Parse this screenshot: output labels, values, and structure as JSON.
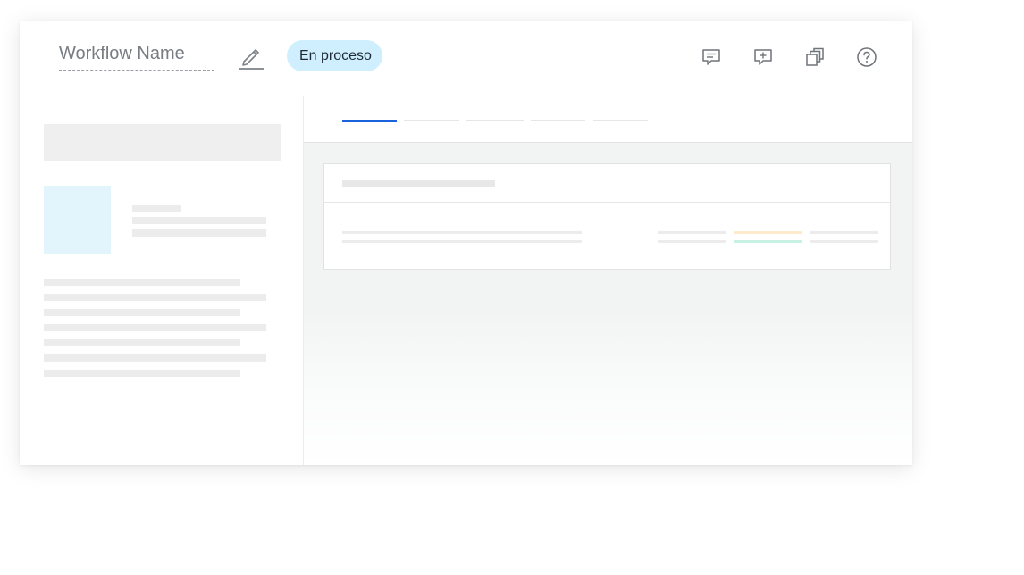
{
  "header": {
    "workflow_name_placeholder": "Workflow Name",
    "status_label": "En proceso",
    "actions": [
      {
        "name": "comments",
        "icon": "comment-icon"
      },
      {
        "name": "add-comment",
        "icon": "add-comment-icon"
      },
      {
        "name": "copy",
        "icon": "copy-icon"
      },
      {
        "name": "help",
        "icon": "help-icon"
      }
    ]
  },
  "tabs": {
    "active_index": 0,
    "count": 5
  },
  "colors": {
    "accent": "#1a63dd",
    "status_badge_bg": "#cfefff",
    "skeleton": "#ececec",
    "thumbnail": "#e3f5fc",
    "highlight_orange": "#fdebcc",
    "highlight_green": "#c7f2e4"
  }
}
